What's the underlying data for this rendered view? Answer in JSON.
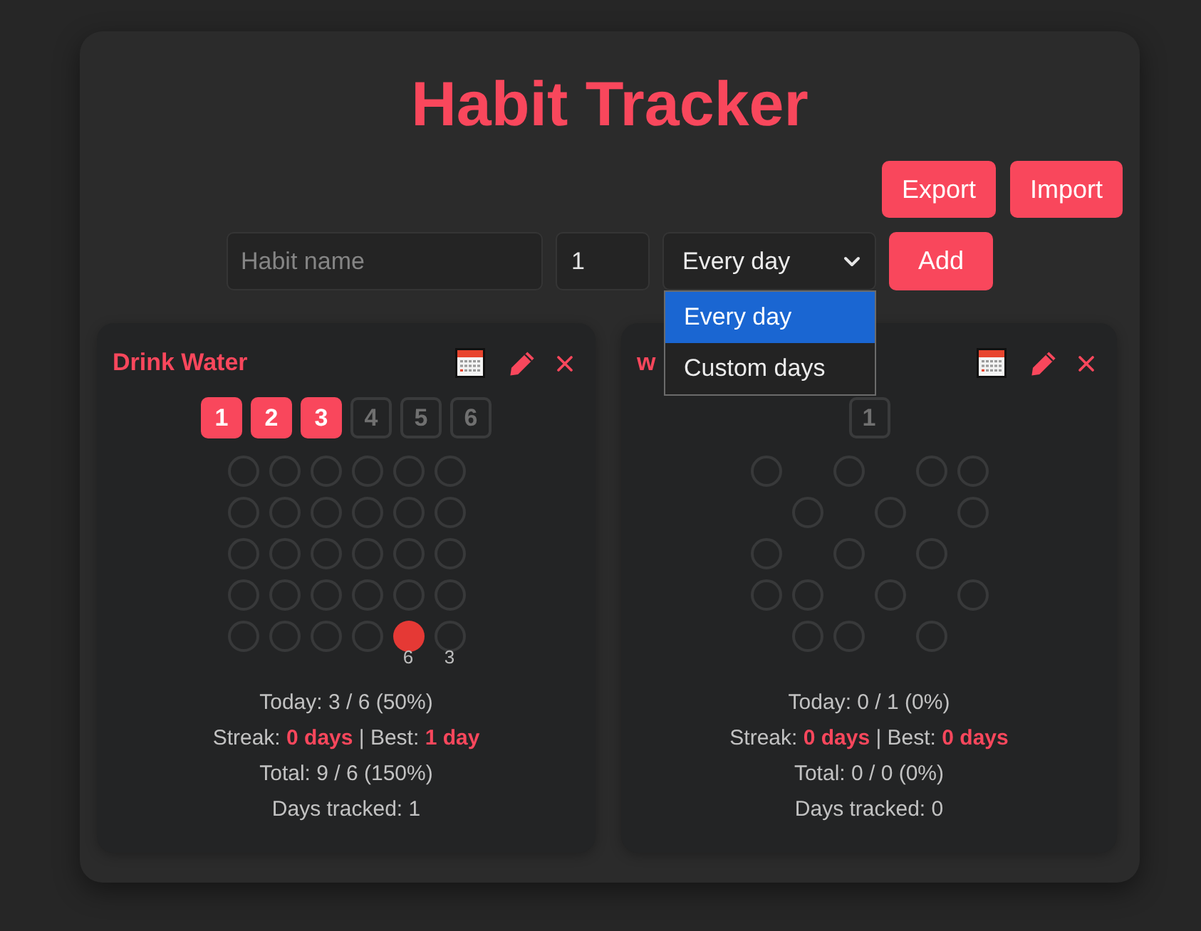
{
  "app": {
    "title": "Habit Tracker"
  },
  "toolbar": {
    "buttons": [
      {
        "label": "Export"
      },
      {
        "label": "Import"
      }
    ]
  },
  "new_habit": {
    "name": {
      "placeholder": "Habit name"
    },
    "target": {
      "value": "1"
    },
    "frequency": {
      "value": "Every day",
      "open": true,
      "options": [
        {
          "label": "Every day",
          "selected": true
        },
        {
          "label": "Custom days",
          "selected": false
        }
      ]
    },
    "add_button": "Add"
  },
  "habits": [
    {
      "name": "Drink Water",
      "counters": [
        {
          "label": "1",
          "done": true
        },
        {
          "label": "2",
          "done": true
        },
        {
          "label": "3",
          "done": true
        },
        {
          "label": "4",
          "done": false
        },
        {
          "label": "5",
          "done": false
        },
        {
          "label": "6",
          "done": false
        }
      ],
      "days": [
        {
          "kind": "open"
        },
        {
          "kind": "open"
        },
        {
          "kind": "open"
        },
        {
          "kind": "open"
        },
        {
          "kind": "open"
        },
        {
          "kind": "open"
        },
        {
          "kind": "open"
        },
        {
          "kind": "open"
        },
        {
          "kind": "open"
        },
        {
          "kind": "open"
        },
        {
          "kind": "open"
        },
        {
          "kind": "open"
        },
        {
          "kind": "open"
        },
        {
          "kind": "open"
        },
        {
          "kind": "open"
        },
        {
          "kind": "open"
        },
        {
          "kind": "open"
        },
        {
          "kind": "open"
        },
        {
          "kind": "open"
        },
        {
          "kind": "open"
        },
        {
          "kind": "open"
        },
        {
          "kind": "open"
        },
        {
          "kind": "open"
        },
        {
          "kind": "open"
        },
        {
          "kind": "open"
        },
        {
          "kind": "open"
        },
        {
          "kind": "open"
        },
        {
          "kind": "open"
        },
        {
          "kind": "done",
          "label": "6"
        },
        {
          "kind": "open",
          "label": "3"
        }
      ],
      "stats": [
        "Today: 3 / 6 (50%)",
        "Streak: **0 days** | Best: **1 day**",
        "Total: 9 / 6 (150%)",
        "Days tracked: 1"
      ]
    },
    {
      "name": "w",
      "counters": [
        {
          "label": "1",
          "done": false
        }
      ],
      "days": [
        {
          "kind": "open"
        },
        {
          "kind": "off"
        },
        {
          "kind": "open"
        },
        {
          "kind": "off"
        },
        {
          "kind": "open"
        },
        {
          "kind": "open"
        },
        {
          "kind": "off"
        },
        {
          "kind": "open"
        },
        {
          "kind": "off"
        },
        {
          "kind": "open"
        },
        {
          "kind": "off"
        },
        {
          "kind": "open"
        },
        {
          "kind": "open"
        },
        {
          "kind": "off"
        },
        {
          "kind": "open"
        },
        {
          "kind": "off"
        },
        {
          "kind": "open"
        },
        {
          "kind": "off"
        },
        {
          "kind": "open"
        },
        {
          "kind": "open"
        },
        {
          "kind": "off"
        },
        {
          "kind": "open"
        },
        {
          "kind": "off"
        },
        {
          "kind": "open"
        },
        {
          "kind": "off"
        },
        {
          "kind": "open"
        },
        {
          "kind": "open"
        },
        {
          "kind": "off"
        },
        {
          "kind": "open"
        },
        {
          "kind": "off"
        }
      ],
      "stats": [
        "Today: 0 / 1 (0%)",
        "Streak: **0 days** | Best: **0 days**",
        "Total: 0 / 0 (0%)",
        "Days tracked: 0"
      ]
    }
  ]
}
